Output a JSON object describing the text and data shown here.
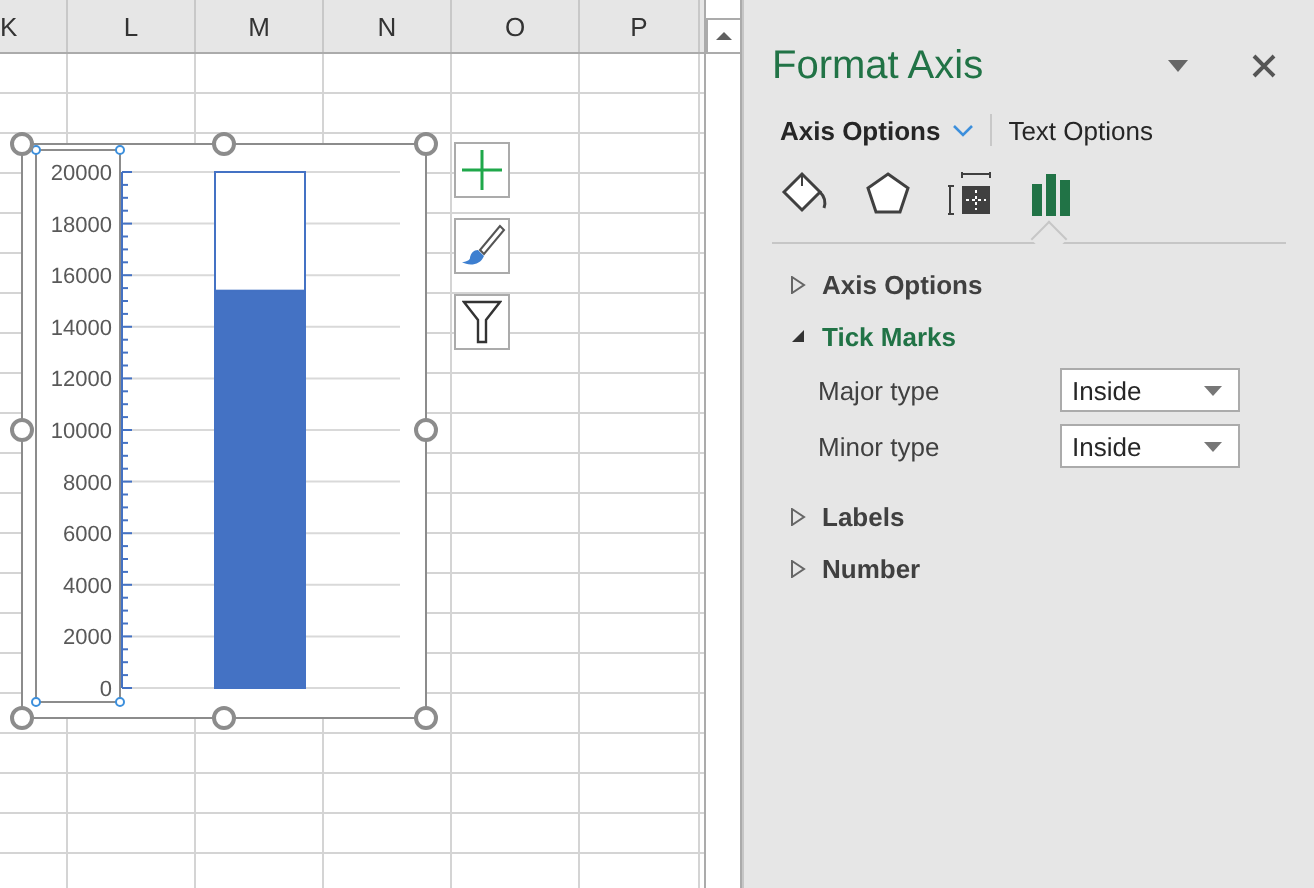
{
  "sheet": {
    "columns": [
      "K",
      "L",
      "M",
      "N",
      "O",
      "P"
    ],
    "chart": {
      "chart_data": {
        "type": "bar",
        "ylim": [
          0,
          20000
        ],
        "yticks": [
          0,
          2000,
          4000,
          6000,
          8000,
          10000,
          12000,
          14000,
          16000,
          18000,
          20000
        ],
        "stacked": true,
        "grid": true,
        "series": [
          {
            "color": "#4472c4",
            "values": [
              15400
            ]
          },
          {
            "color": "#ffffff",
            "values": [
              4600
            ]
          }
        ]
      }
    }
  },
  "panel": {
    "title": "Format Axis",
    "option_tabs": [
      {
        "label": "Axis Options",
        "selected": true
      },
      {
        "label": "Text Options",
        "selected": false
      }
    ],
    "icon_tabs": [
      {
        "kind": "fill",
        "selected": false
      },
      {
        "kind": "effects",
        "selected": false
      },
      {
        "kind": "size",
        "selected": false
      },
      {
        "kind": "options",
        "selected": true
      }
    ],
    "sections": [
      {
        "label": "Axis Options",
        "expanded": false
      },
      {
        "label": "Tick Marks",
        "expanded": true,
        "fields": [
          {
            "label": "Major type",
            "value": "Inside"
          },
          {
            "label": "Minor type",
            "value": "Inside"
          }
        ]
      },
      {
        "label": "Labels",
        "expanded": false
      },
      {
        "label": "Number",
        "expanded": false
      }
    ]
  }
}
